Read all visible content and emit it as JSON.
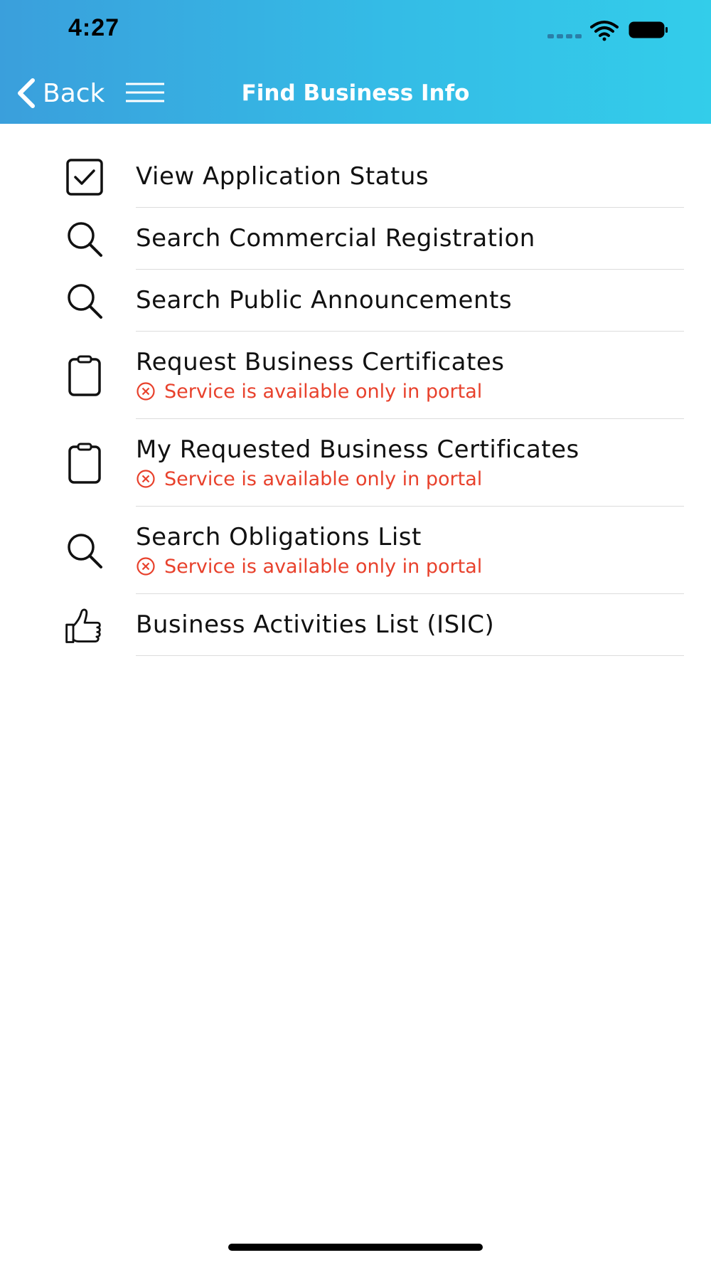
{
  "status_bar": {
    "time": "4:27"
  },
  "nav": {
    "back_label": "Back",
    "title": "Find Business Info"
  },
  "items": [
    {
      "icon": "checkbox-icon",
      "label": "View Application Status",
      "note": ""
    },
    {
      "icon": "search-icon",
      "label": "Search Commercial Registration",
      "note": ""
    },
    {
      "icon": "search-icon",
      "label": "Search Public Announcements",
      "note": ""
    },
    {
      "icon": "clipboard-icon",
      "label": "Request Business Certificates",
      "note": "Service is available only in portal"
    },
    {
      "icon": "clipboard-icon",
      "label": "My Requested Business Certificates",
      "note": "Service is available only in portal"
    },
    {
      "icon": "search-icon",
      "label": "Search Obligations List",
      "note": "Service is available only in portal"
    },
    {
      "icon": "thumbs-up-icon",
      "label": "Business Activities List (ISIC)",
      "note": ""
    }
  ],
  "colors": {
    "header_gradient_start": "#3a9fdc",
    "header_gradient_end": "#33cdea",
    "warning": "#e8412c"
  }
}
